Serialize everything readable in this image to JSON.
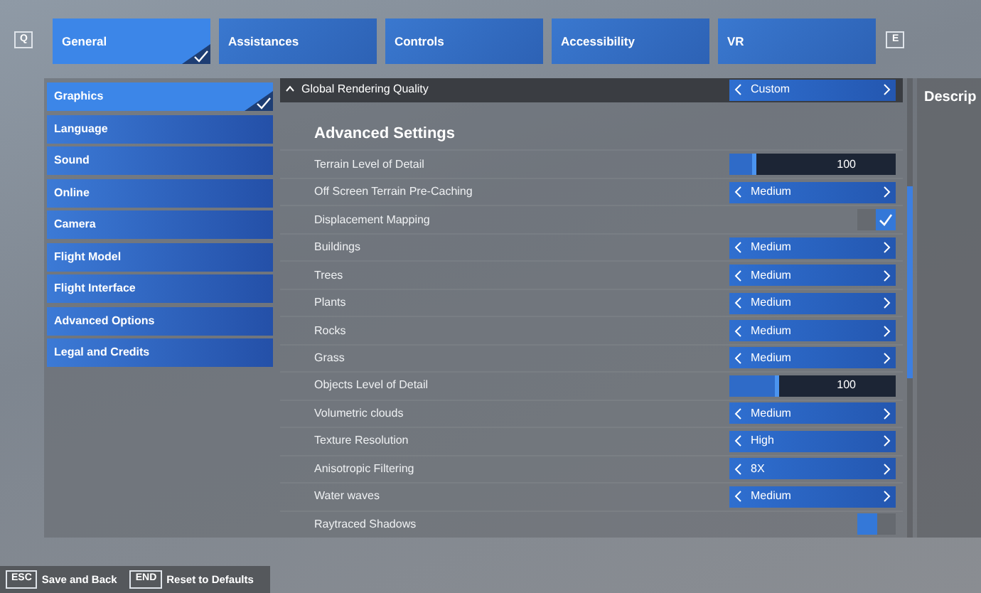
{
  "tab_keys": {
    "previous": "Q",
    "next": "E"
  },
  "tabs": [
    {
      "label": "General",
      "selected": true
    },
    {
      "label": "Assistances",
      "selected": false
    },
    {
      "label": "Controls",
      "selected": false
    },
    {
      "label": "Accessibility",
      "selected": false
    },
    {
      "label": "VR",
      "selected": false
    }
  ],
  "sidebar": {
    "items": [
      {
        "label": "Graphics",
        "selected": true
      },
      {
        "label": "Language",
        "selected": false
      },
      {
        "label": "Sound",
        "selected": false
      },
      {
        "label": "Online",
        "selected": false
      },
      {
        "label": "Camera",
        "selected": false
      },
      {
        "label": "Flight Model",
        "selected": false
      },
      {
        "label": "Flight Interface",
        "selected": false
      },
      {
        "label": "Advanced Options",
        "selected": false
      },
      {
        "label": "Legal and Credits",
        "selected": false
      }
    ]
  },
  "global_quality": {
    "label": "Global Rendering Quality",
    "expanded": true,
    "value": "Custom"
  },
  "section_title": "Advanced Settings",
  "settings": [
    {
      "label": "Terrain Level of Detail",
      "kind": "slider",
      "level": 0.16,
      "reading": "100"
    },
    {
      "label": "Off Screen Terrain Pre-Caching",
      "kind": "select",
      "value": "Medium"
    },
    {
      "label": "Displacement Mapping",
      "kind": "toggle",
      "checked": true
    },
    {
      "label": "Buildings",
      "kind": "select",
      "value": "Medium"
    },
    {
      "label": "Trees",
      "kind": "select",
      "value": "Medium"
    },
    {
      "label": "Plants",
      "kind": "select",
      "value": "Medium"
    },
    {
      "label": "Rocks",
      "kind": "select",
      "value": "Medium"
    },
    {
      "label": "Grass",
      "kind": "select",
      "value": "Medium"
    },
    {
      "label": "Objects Level of Detail",
      "kind": "slider",
      "level": 0.3,
      "reading": "100"
    },
    {
      "label": "Volumetric clouds",
      "kind": "select",
      "value": "Medium"
    },
    {
      "label": "Texture Resolution",
      "kind": "select",
      "value": "High"
    },
    {
      "label": "Anisotropic Filtering",
      "kind": "select",
      "value": "8X"
    },
    {
      "label": "Water waves",
      "kind": "select",
      "value": "Medium"
    },
    {
      "label": "Raytraced Shadows",
      "kind": "toggle",
      "checked": false
    }
  ],
  "description": {
    "title": "Descrip"
  },
  "footer": [
    {
      "key": "ESC",
      "label": "Save and Back"
    },
    {
      "key": "END",
      "label": "Reset to Defaults"
    }
  ]
}
